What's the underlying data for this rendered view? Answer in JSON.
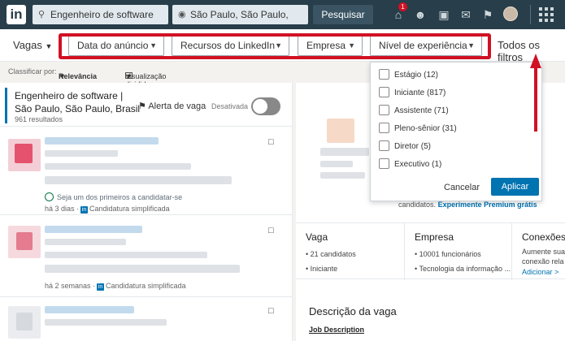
{
  "topnav": {
    "logo": "in",
    "search_keywords": "Engenheiro de software",
    "search_location": "São Paulo, São Paulo, Brasil",
    "search_button": "Pesquisar",
    "notification_count": "1",
    "icons": [
      "home-icon",
      "network-icon",
      "jobs-icon",
      "messaging-icon",
      "notifications-icon",
      "avatar",
      "apps-grid-icon"
    ]
  },
  "filters": {
    "vagas_label": "Vagas",
    "pills": [
      "Data do anúncio",
      "Recursos do LinkedIn",
      "Empresa",
      "Nível de experiência"
    ],
    "all_filters": "Todos os filtros"
  },
  "sortbar": {
    "sort_prefix": "Classificar por:",
    "sort_value": "Relevância",
    "view_label": "Visualização dividida"
  },
  "alert": {
    "title_line1": "Engenheiro de software |",
    "title_line2": "São Paulo, São Paulo, Brasil",
    "results": "961 resultados",
    "alert_label": "Alerta de vaga",
    "toggle_state": "Desativada"
  },
  "cards": [
    {
      "early_text": "Seja um dos primeiros a candidatar-se",
      "age": "há 3 dias",
      "apply_type": "Candidatura simplificada"
    },
    {
      "age": "há 2 semanas",
      "apply_type": "Candidatura simplificada"
    }
  ],
  "dropdown": {
    "options": [
      "Estágio (12)",
      "Iniciante (817)",
      "Assistente (71)",
      "Pleno-sênior (31)",
      "Diretor (5)",
      "Executivo (1)"
    ],
    "cancel": "Cancelar",
    "apply": "Aplicar"
  },
  "detail": {
    "premium_prefix": "candidatos.",
    "premium_link": "Experimente Premium grátis",
    "col_vaga": {
      "title": "Vaga",
      "lines": [
        "21 candidatos",
        "Iniciante"
      ]
    },
    "col_empresa": {
      "title": "Empresa",
      "lines": [
        "10001 funcionários",
        "Tecnologia da informação ..."
      ]
    },
    "col_conexoes": {
      "title": "Conexões",
      "lines": [
        "Aumente sua",
        "conexão rela"
      ],
      "link": "Adicionar >"
    },
    "description_title": "Descrição da vaga",
    "job_description_heading": "Job Description"
  },
  "colors": {
    "nav": "#283e4a",
    "accent": "#0073b1",
    "highlight": "#d11124"
  }
}
